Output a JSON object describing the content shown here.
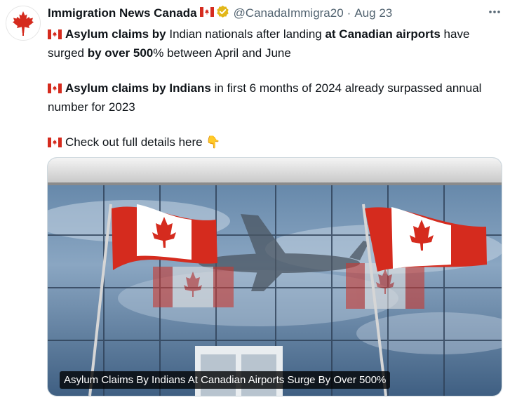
{
  "tweet": {
    "author_name": "Immigration News Canada",
    "author_flag": "🇨🇦",
    "handle": "@CanadaImmigra20",
    "separator": "·",
    "date": "Aug 23",
    "more_icon": "ellipsis-icon",
    "paragraphs": [
      {
        "flag": "🇨🇦",
        "segments": [
          {
            "text": "Asylum claims by",
            "bold": true
          },
          {
            "text": " Indian nationals after landing ",
            "bold": false
          },
          {
            "text": "at Canadian airports",
            "bold": true
          },
          {
            "text": " have surged ",
            "bold": false
          },
          {
            "text": "by over 500",
            "bold": true
          },
          {
            "text": "% between April and June",
            "bold": false
          }
        ]
      },
      {
        "flag": "🇨🇦",
        "segments": [
          {
            "text": "Asylum claims by Indians",
            "bold": true
          },
          {
            "text": " in first 6 months of 2024 already surpassed annual number for 2023",
            "bold": false
          }
        ]
      },
      {
        "flag": "🇨🇦",
        "segments": [
          {
            "text": "Check out full details here ",
            "bold": false
          },
          {
            "text": "👇",
            "bold": false
          }
        ]
      }
    ],
    "media": {
      "caption": "Asylum Claims By Indians At Canadian Airports Surge By Over 500%"
    }
  },
  "colors": {
    "text": "#0f1419",
    "secondary": "#536471",
    "canada_red": "#d52b1e",
    "verified_gold": "#e2b719"
  }
}
